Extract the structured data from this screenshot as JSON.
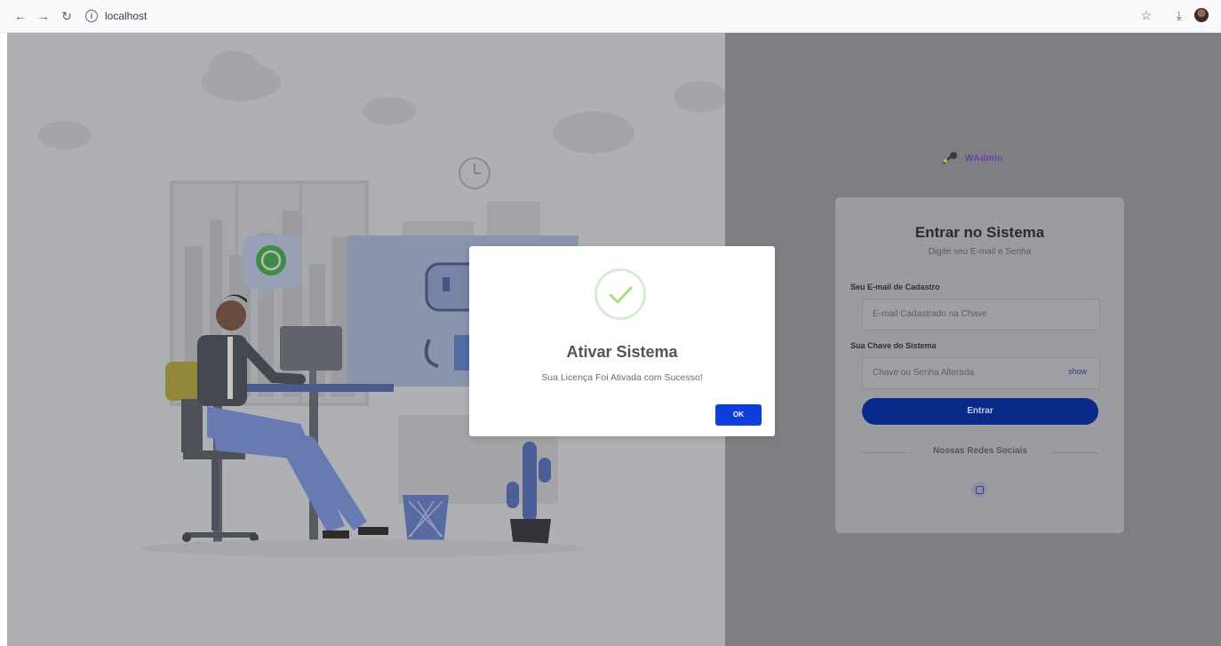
{
  "browser": {
    "url": "localhost",
    "icons": {
      "back": "arrow-left-icon",
      "forward": "arrow-right-icon",
      "reload": "reload-icon",
      "info": "info-icon",
      "bookmark": "star-icon",
      "download": "download-icon",
      "profile": "avatar"
    }
  },
  "login": {
    "logo_text": "WAdmin",
    "title": "Entrar no Sistema",
    "subtitle": "Digite seu E-mail e Senha",
    "email_label": "Seu E-mail de Cadastro",
    "email_placeholder": "E-mail Cadastrado na Chave",
    "key_label": "Sua Chave do Sistema",
    "key_placeholder": "Chave ou Senha Alterada",
    "show_label": "show",
    "enter_label": "Entrar",
    "social_label": "Nossas Redes Sociais",
    "social_icon": "instagram-icon"
  },
  "modal": {
    "title": "Ativar Sistema",
    "message": "Sua Licença Foi Ativada com Sucesso!",
    "ok_label": "OK",
    "icon": "success-check-icon"
  },
  "colors": {
    "accent": "#0d3fdc",
    "success": "#a5dc86",
    "enter_button": "#0a2a8a"
  }
}
